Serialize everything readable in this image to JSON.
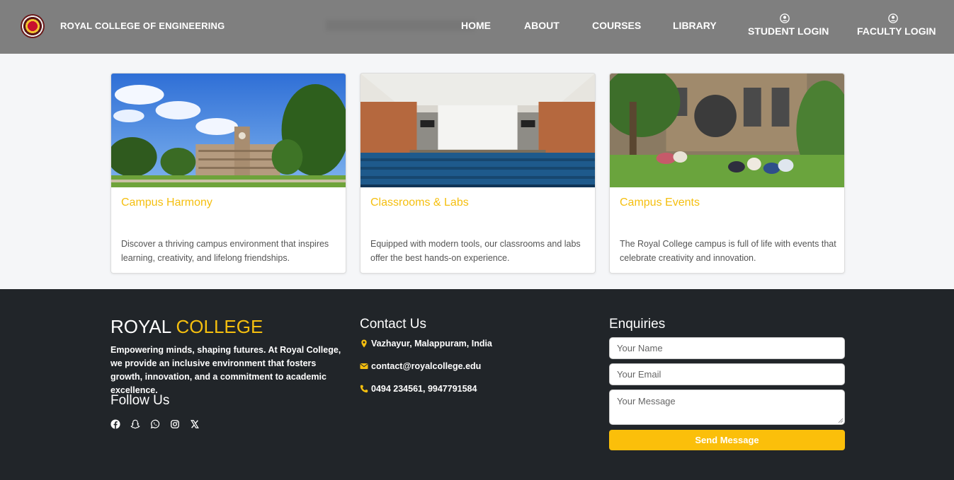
{
  "header": {
    "brand": "ROYAL COLLEGE OF ENGINEERING",
    "nav": {
      "home": "HOME",
      "about": "ABOUT",
      "courses": "COURSES",
      "library": "LIBRARY",
      "student_login": "STUDENT LOGIN",
      "faculty_login": "FACULTY LOGIN"
    }
  },
  "cards": [
    {
      "title": "Campus Harmony",
      "text": "Discover a thriving campus environment that inspires learning, creativity, and lifelong friendships."
    },
    {
      "title": "Classrooms & Labs",
      "text": "Equipped with modern tools, our classrooms and labs offer the best hands-on experience."
    },
    {
      "title": "Campus Events",
      "text": "The Royal College campus is full of life with events that celebrate creativity and innovation."
    }
  ],
  "footer": {
    "brand_main": "ROYAL",
    "brand_accent": "COLLEGE",
    "description": "Empowering minds, shaping futures. At Royal College, we provide an inclusive environment that fosters growth, innovation, and a commitment to academic excellence.",
    "follow_heading": "Follow Us",
    "socials": [
      "facebook-icon",
      "snapchat-icon",
      "whatsapp-icon",
      "instagram-icon",
      "x-icon"
    ],
    "contact_heading": "Contact Us",
    "contact": {
      "address": "Vazhayur, Malappuram, India",
      "email": "contact@royalcollege.edu",
      "phone": "0494 234561, 9947791584"
    },
    "enquiries": {
      "heading": "Enquiries",
      "name_placeholder": "Your Name",
      "email_placeholder": "Your Email",
      "message_placeholder": "Your Message",
      "send_label": "Send Message"
    }
  },
  "colors": {
    "navbar": "#7f7f7f",
    "accent": "#f5bf0f",
    "footer_bg": "#212529",
    "button": "#fbbf0a"
  }
}
